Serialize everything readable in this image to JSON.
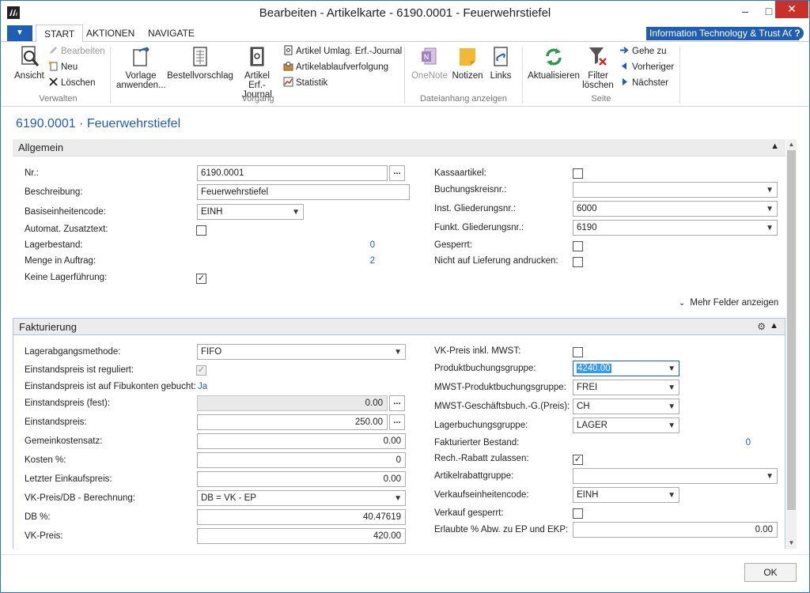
{
  "window": {
    "title": "Bearbeiten - Artikelkarte - 6190.0001 - Feuerwehrstiefel"
  },
  "tabs": {
    "file": "▼",
    "start": "START",
    "aktionen": "AKTIONEN",
    "navigate": "NAVIGATE"
  },
  "company": "Information Technology & Trust AG",
  "help": "?",
  "ribbon": {
    "ansicht": "Ansicht",
    "bearbeiten": "Bearbeiten",
    "neu": "Neu",
    "loeschen": "Löschen",
    "grp_verwalten": "Verwalten",
    "vorlage_1": "Vorlage",
    "vorlage_2": "anwenden...",
    "bestellvorschlag": "Bestellvorschlag",
    "artikel_erf_1": "Artikel Erf.-",
    "artikel_erf_2": "Journal",
    "umlag_journal": "Artikel Umlag. Erf.-Journal",
    "ablaufverfolgung": "Artikelablaufverfolgung",
    "statistik": "Statistik",
    "grp_vorgang": "Vorgang",
    "onenote": "OneNote",
    "notizen": "Notizen",
    "links": "Links",
    "grp_dateianhang": "Dateianhang anzeigen",
    "aktualisieren": "Aktualisieren",
    "filter_1": "Filter",
    "filter_2": "löschen",
    "gehe_zu": "Gehe zu",
    "vorheriger": "Vorheriger",
    "naechster": "Nächster",
    "grp_seite": "Seite"
  },
  "page_title": "6190.0001 · Feuerwehrstiefel",
  "allgemein": {
    "title": "Allgemein",
    "nr_label": "Nr.:",
    "nr_value": "6190.0001",
    "beschreibung_label": "Beschreibung:",
    "beschreibung_value": "Feuerwehrstiefel",
    "basiseinheit_label": "Basiseinheitencode:",
    "basiseinheit_value": "EINH",
    "automat_label": "Automat. Zusatztext:",
    "lagerbestand_label": "Lagerbestand:",
    "lagerbestand_value": "0",
    "menge_label": "Menge in Auftrag:",
    "menge_value": "2",
    "keine_lager_label": "Keine Lagerführung:",
    "kassa_label": "Kassaartikel:",
    "buchungskreis_label": "Buchungskreisnr.:",
    "buchungskreis_value": "",
    "inst_label": "Inst. Gliederungsnr.:",
    "inst_value": "6000",
    "funkt_label": "Funkt. Gliederungsnr.:",
    "funkt_value": "6190",
    "gesperrt_label": "Gesperrt:",
    "nicht_lief_label": "Nicht auf Lieferung andrucken:",
    "mehr_felder": "Mehr Felder anzeigen"
  },
  "fakturierung": {
    "title": "Fakturierung",
    "lagerabgang_label": "Lagerabgangsmethode:",
    "lagerabgang_value": "FIFO",
    "einst_reguliert_label": "Einstandspreis ist reguliert:",
    "einst_gebucht_label": "Einstandspreis ist auf Fibukonten gebucht:",
    "einst_gebucht_value": "Ja",
    "einst_fest_label": "Einstandspreis (fest):",
    "einst_fest_value": "0.00",
    "einst_label": "Einstandspreis:",
    "einst_value": "250.00",
    "gemeinkosten_label": "Gemeinkostensatz:",
    "gemeinkosten_value": "0.00",
    "kosten_label": "Kosten %:",
    "kosten_value": "0",
    "letzter_ek_label": "Letzter Einkaufspreis:",
    "letzter_ek_value": "0.00",
    "vk_db_label": "VK-Preis/DB - Berechnung:",
    "vk_db_value": "DB = VK - EP",
    "db_label": "DB %:",
    "db_value": "40.47619",
    "vk_label": "VK-Preis:",
    "vk_value": "420.00",
    "vk_mwst_label": "VK-Preis inkl. MWST:",
    "produkt_label": "Produktbuchungsgruppe:",
    "produkt_value": "4240.00",
    "mwst_produkt_label": "MWST-Produktbuchungsgruppe:",
    "mwst_produkt_value": "FREI",
    "mwst_gesch_label": "MWST-Geschäftsbuch.-G.(Preis):",
    "mwst_gesch_value": "CH",
    "lagerbuchung_label": "Lagerbuchungsgruppe:",
    "lagerbuchung_value": "LAGER",
    "fakt_bestand_label": "Fakturierter Bestand:",
    "fakt_bestand_value": "0",
    "rech_rabatt_label": "Rech.-Rabatt zulassen:",
    "artikelrabatt_label": "Artikelrabattgruppe:",
    "artikelrabatt_value": "",
    "verkaufseinheit_label": "Verkaufseinheitencode:",
    "verkaufseinheit_value": "EINH",
    "verkauf_gesperrt_label": "Verkauf gesperrt:",
    "erlaubte_label": "Erlaubte % Abw. zu EP und EKP:",
    "erlaubte_value": "0.00"
  },
  "footer": {
    "ok": "OK"
  }
}
